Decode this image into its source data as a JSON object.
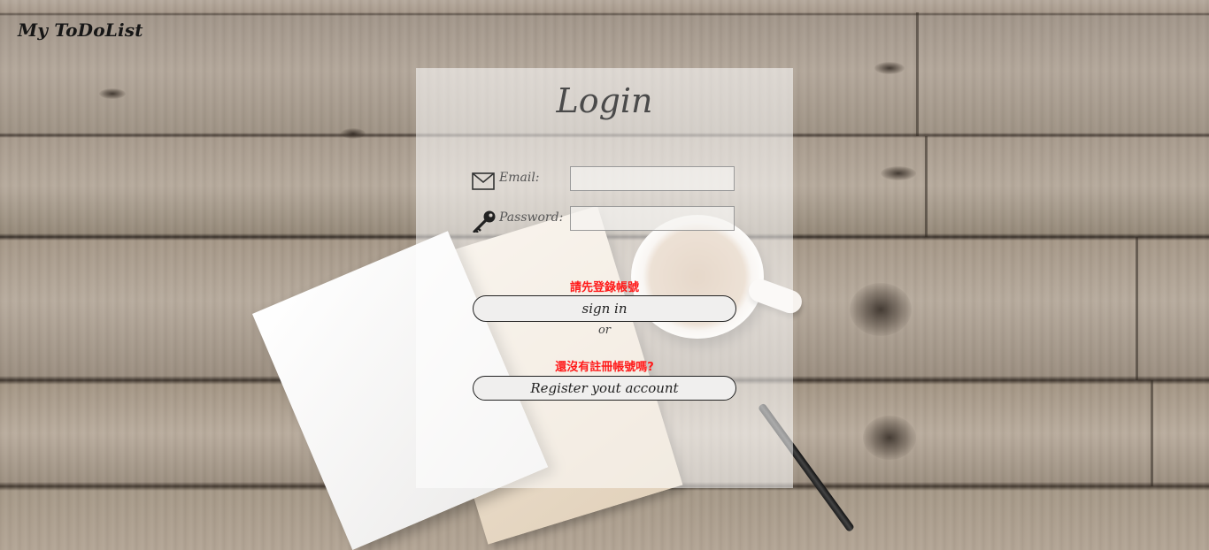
{
  "brand": {
    "title": "My ToDoList"
  },
  "login": {
    "title": "Login",
    "email_label": "Email:",
    "email_value": "",
    "password_label": "Password:",
    "password_value": "",
    "signin_message": "請先登錄帳號",
    "signin_button": "sign in",
    "or_text": "or",
    "register_message": "還沒有註冊帳號嗎?",
    "register_button": "Register yout account"
  },
  "icons": {
    "email": "envelope-icon",
    "password": "key-icon"
  },
  "colors": {
    "warning_text": "#ff1a1a",
    "panel_bg": "rgba(255,255,255,0.55)",
    "button_bg": "#f0efee"
  }
}
